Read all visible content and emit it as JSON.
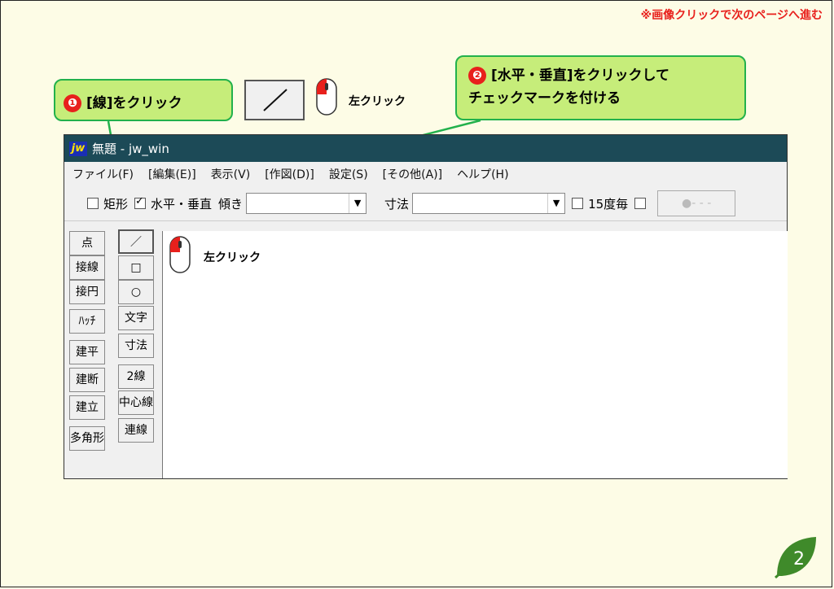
{
  "top_note": "※画像クリックで次のページへ進む",
  "callout1": {
    "num": "❶",
    "text": "[線]をクリック"
  },
  "callout2": {
    "num": "❷",
    "line1": "[水平・垂直]をクリックして",
    "line2": "チェックマークを付ける"
  },
  "mouse_label_top": "左クリック",
  "mouse_label_canvas": "左クリック",
  "window": {
    "title": "無題 - jw_win",
    "logo": "jw",
    "menu": [
      "ファイル(F)",
      "[編集(E)]",
      "表示(V)",
      "[作図(D)]",
      "設定(S)",
      "[その他(A)]",
      "ヘルプ(H)"
    ],
    "toolbar": {
      "rect_label": "矩形",
      "hv_label": "水平・垂直",
      "incline_label": "傾き",
      "dim_label": "寸法",
      "deg15_label": "15度毎",
      "linetype_label": "●- - -"
    },
    "left_col": [
      "点",
      "接線",
      "接円",
      "ﾊｯﾁ",
      "建平",
      "建断",
      "建立",
      "多角形"
    ],
    "right_col": [
      "／",
      "□",
      "○",
      "文字",
      "寸法",
      "2線",
      "中心線",
      "連線"
    ]
  },
  "page_number": "2",
  "colors": {
    "callout_bg": "#c6ed7a",
    "callout_border": "#22b14c",
    "accent_red": "#e8201c",
    "titlebar": "#1c4a57"
  }
}
